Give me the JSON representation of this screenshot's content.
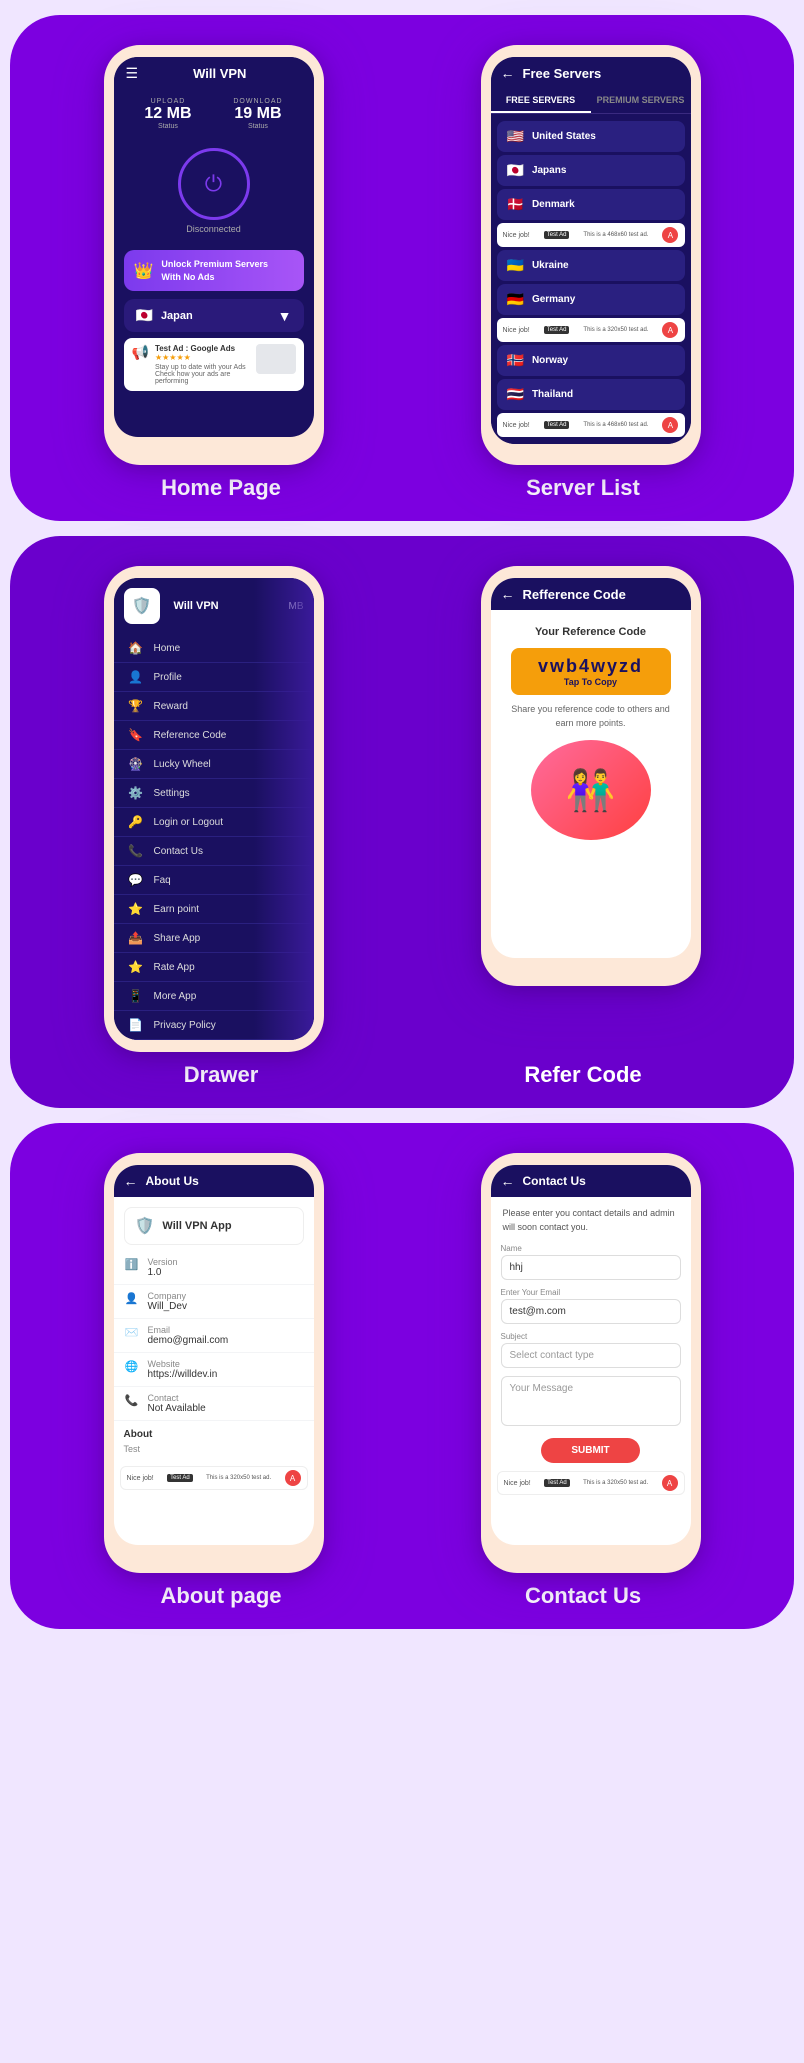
{
  "sections": [
    {
      "id": "home-server",
      "label_left": "Home Page",
      "label_right": "Server List"
    },
    {
      "id": "drawer-refer",
      "label_left": "Drawer",
      "label_right": "Refer Code"
    },
    {
      "id": "about-contact",
      "label_left": "About page",
      "label_right": "Contact Us"
    }
  ],
  "home": {
    "title": "Will VPN",
    "upload_label": "UPLOAD",
    "upload_value": "12 MB",
    "upload_sub": "Status",
    "download_label": "DOWNLOAD",
    "download_value": "19 MB",
    "download_sub": "Status",
    "status": "Disconnected",
    "premium_line1": "Unlock Premium Servers",
    "premium_line2": "With No Ads",
    "server": "Japan",
    "ad_title": "Test Ad : Google Ads",
    "ad_desc": "Stay up to date with your Ads Check how your ads are performing"
  },
  "server_list": {
    "title": "Free Servers",
    "tab_free": "FREE SERVERS",
    "tab_premium": "PREMIUM SERVERS",
    "servers": [
      {
        "flag": "🇺🇸",
        "name": "United States"
      },
      {
        "flag": "🇯🇵",
        "name": "Japans"
      },
      {
        "flag": "🇩🇰",
        "name": "Denmark"
      },
      {
        "flag": "🇺🇦",
        "name": "Ukraine"
      },
      {
        "flag": "🇩🇪",
        "name": "Germany"
      },
      {
        "flag": "🇳🇴",
        "name": "Norway"
      },
      {
        "flag": "🇹🇭",
        "name": "Thailand"
      }
    ],
    "ad_nice": "Nice job!",
    "ad_text": "This is a 468x60 test ad.",
    "ad_text2": "This is a 320x50 test ad."
  },
  "drawer": {
    "app_name": "Will VPN",
    "items": [
      {
        "icon": "🏠",
        "label": "Home"
      },
      {
        "icon": "👤",
        "label": "Profile"
      },
      {
        "icon": "🏆",
        "label": "Reward"
      },
      {
        "icon": "🔖",
        "label": "Reference Code"
      },
      {
        "icon": "🎡",
        "label": "Lucky Wheel"
      },
      {
        "icon": "⚙️",
        "label": "Settings"
      },
      {
        "icon": "🔑",
        "label": "Login or Logout"
      },
      {
        "icon": "📞",
        "label": "Contact Us"
      },
      {
        "icon": "💬",
        "label": "Faq"
      },
      {
        "icon": "⭐",
        "label": "Earn point"
      },
      {
        "icon": "📤",
        "label": "Share App"
      },
      {
        "icon": "⭐",
        "label": "Rate App"
      },
      {
        "icon": "📱",
        "label": "More App"
      },
      {
        "icon": "📄",
        "label": "Privacy Policy"
      }
    ]
  },
  "refer": {
    "title": "Refference Code",
    "subtitle": "Your Reference Code",
    "code": "vwb4wyzd",
    "tap_label": "Tap To Copy",
    "desc": "Share you reference code to others and earn more points."
  },
  "about": {
    "title": "About Us",
    "app_name": "Will VPN App",
    "version_label": "Version",
    "version_value": "1.0",
    "company_label": "Company",
    "company_value": "Will_Dev",
    "email_label": "Email",
    "email_value": "demo@gmail.com",
    "website_label": "Website",
    "website_value": "https://willdev.in",
    "contact_label": "Contact",
    "contact_value": "Not Available",
    "about_section": "About",
    "about_test": "Test",
    "ad_nice": "Nice job!",
    "ad_text": "This is a 320x50 test ad."
  },
  "contact": {
    "title": "Contact Us",
    "desc": "Please enter you contact details and admin will soon contact you.",
    "name_label": "Name",
    "name_value": "hhj",
    "email_label": "Enter Your Email",
    "email_value": "test@m.com",
    "subject_label": "Subject",
    "select_placeholder": "Select contact type",
    "message_placeholder": "Your Message",
    "submit_label": "SUBMIT",
    "ad_nice": "Nice job!",
    "ad_text": "This is a 320x50 test ad."
  }
}
